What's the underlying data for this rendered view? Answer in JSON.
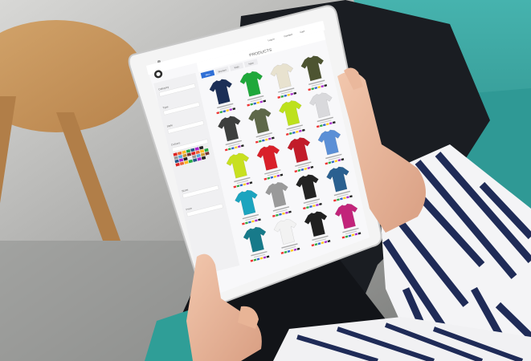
{
  "screen": {
    "header_links": [
      "Log in",
      "Contact",
      "Cart"
    ],
    "title": "PRODUCTS",
    "tabs": [
      "Men",
      "Women",
      "Kids",
      "New"
    ],
    "active_tab": 0,
    "sidebar_headings": [
      "Category",
      "Type",
      "Style",
      "Colours",
      "Sizes",
      "Price"
    ],
    "products": [
      {
        "color": "#1c2f57"
      },
      {
        "color": "#1fa83a"
      },
      {
        "color": "#e8e2cf"
      },
      {
        "color": "#4d5431"
      },
      {
        "color": "#3d3f3e"
      },
      {
        "color": "#5e6849"
      },
      {
        "color": "#bde11c"
      },
      {
        "color": "#d9d9dc"
      },
      {
        "color": "#c8e020"
      },
      {
        "color": "#d9202a"
      },
      {
        "color": "#c21c2a"
      },
      {
        "color": "#5b8fd6"
      },
      {
        "color": "#1ca4bf"
      },
      {
        "color": "#9a9a9a"
      },
      {
        "color": "#232323"
      },
      {
        "color": "#2a6090"
      },
      {
        "color": "#177a8a"
      },
      {
        "color": "#f2f2f2"
      },
      {
        "color": "#202020"
      },
      {
        "color": "#c2247a"
      }
    ]
  },
  "colors": {
    "accent": "#2f6fd6",
    "sofa": "#3aa3a1",
    "table": "#c99a63"
  }
}
